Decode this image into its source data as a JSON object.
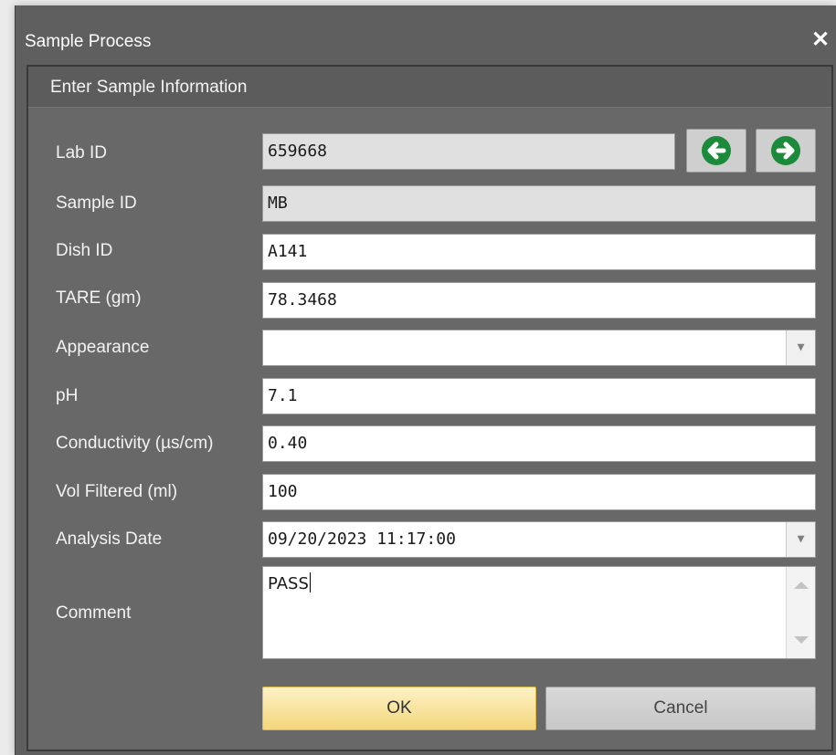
{
  "window": {
    "title": "Sample Process",
    "close_symbol": "✕"
  },
  "group": {
    "title": "Enter Sample Information"
  },
  "fields": {
    "lab_id": {
      "label": "Lab ID",
      "value": "659668"
    },
    "sample_id": {
      "label": "Sample ID",
      "value": "MB"
    },
    "dish_id": {
      "label": "Dish ID",
      "value": "A141"
    },
    "tare": {
      "label": "TARE (gm)",
      "value": "78.3468"
    },
    "appearance": {
      "label": "Appearance",
      "value": ""
    },
    "ph": {
      "label": "pH",
      "value": "7.1"
    },
    "conductivity": {
      "label": "Conductivity (µs/cm)",
      "value": "0.40"
    },
    "vol_filtered": {
      "label": "Vol Filtered (ml)",
      "value": "100"
    },
    "analysis_date": {
      "label": "Analysis Date",
      "value": "09/20/2023 11:17:00"
    },
    "comment": {
      "label": "Comment",
      "value": "PASS"
    }
  },
  "buttons": {
    "ok": "OK",
    "cancel": "Cancel"
  },
  "icons": {
    "previous": "arrow-left-circle-icon",
    "next": "arrow-right-circle-icon",
    "dropdown": "chevron-down-icon",
    "close": "close-icon"
  },
  "colors": {
    "nav_green": "#1b8a3a",
    "ok_button": "#f6dc8c",
    "window_bg": "#5f5f5f"
  }
}
